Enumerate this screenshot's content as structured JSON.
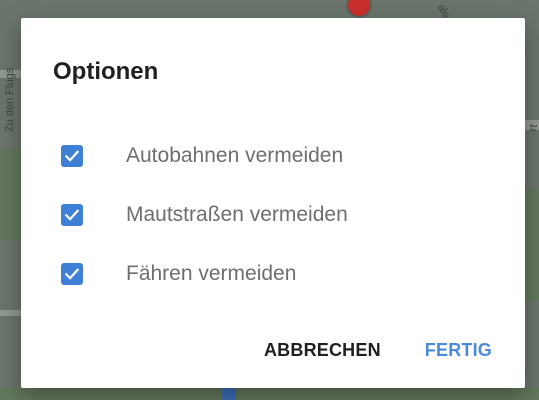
{
  "map": {
    "label_left": "Zu den Flugs",
    "label_top_right": "ale",
    "label_right": "rt"
  },
  "dialog": {
    "title": "Optionen",
    "options": [
      {
        "label": "Autobahnen vermeiden",
        "checked": true
      },
      {
        "label": "Mautstraßen vermeiden",
        "checked": true
      },
      {
        "label": "Fähren vermeiden",
        "checked": true
      }
    ],
    "cancel_label": "ABBRECHEN",
    "done_label": "FERTIG"
  },
  "colors": {
    "checkbox": "#3f7fd6",
    "done_button": "#4a8ad8",
    "title": "#202020",
    "option_text": "#6e6e6e"
  }
}
